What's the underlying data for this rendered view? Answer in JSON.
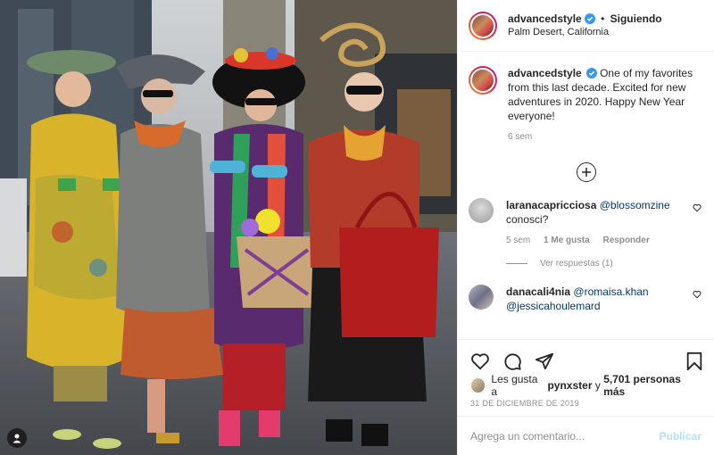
{
  "post": {
    "username": "advancedstyle",
    "follow_label": "Siguiendo",
    "separator": "•",
    "location": "Palm Desert, California",
    "caption_text": "One of my favorites from this last decade. Excited for new adventures in 2020. Happy New Year everyone!",
    "caption_time": "6 sem"
  },
  "comments": [
    {
      "username": "laranacapricciosa",
      "mention": "@blossomzine",
      "text": "conosci?",
      "time": "5 sem",
      "likes": "1 Me gusta",
      "reply_label": "Responder",
      "view_replies": "Ver respuestas (1)"
    },
    {
      "username": "danacali4nia",
      "mention": "@romaisa.khan",
      "mention2": "@jessicahoulemard"
    }
  ],
  "likes_line": {
    "prefix": "Les gusta a",
    "user": "pynxster",
    "middle": "y",
    "count": "5,701 personas más"
  },
  "date": "31 DE DICIEMBRE DE 2019",
  "comment_box": {
    "placeholder": "Agrega un comentario...",
    "post_label": "Publicar"
  },
  "icons": [
    "heart-icon",
    "comment-icon",
    "share-icon",
    "bookmark-icon",
    "verified-badge-icon",
    "plus-circle-icon",
    "user-tag-icon"
  ],
  "colors": {
    "link": "#00376b",
    "verified": "#3897f0",
    "muted": "#8e8e8e",
    "publish_disabled": "#b2dffc"
  }
}
